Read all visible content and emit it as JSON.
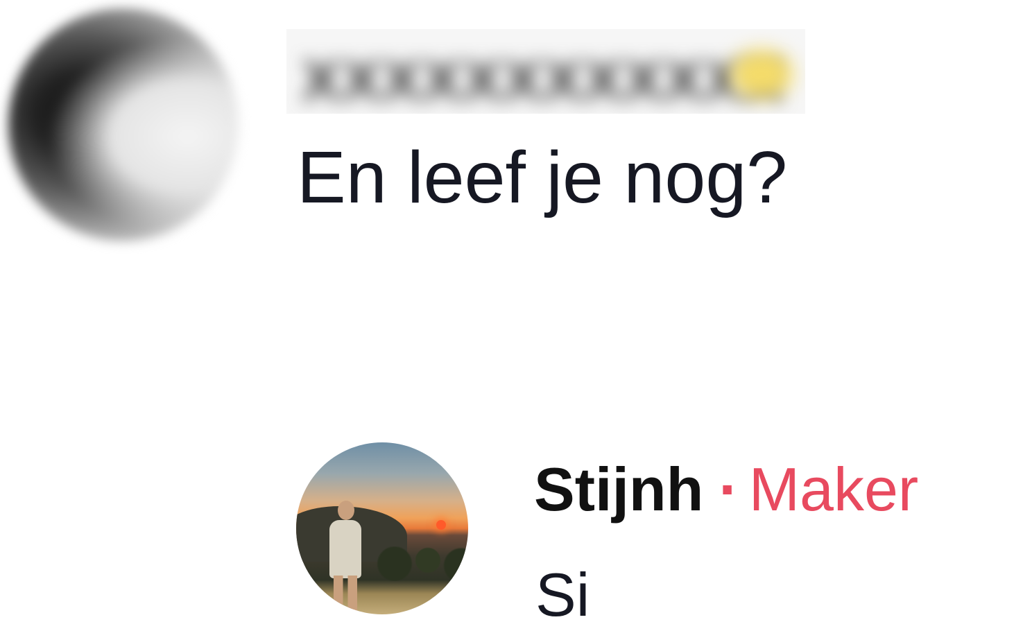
{
  "comments": [
    {
      "username": "",
      "avatar_icon": "blurred-profile-avatar",
      "text": "En leef je nog?"
    }
  ],
  "reply": {
    "username": "Stijnh",
    "separator": "·",
    "creator_label": "Maker",
    "avatar_icon": "sunset-profile-avatar",
    "text": "Si"
  },
  "colors": {
    "creator_accent": "#e84a5f",
    "text_primary": "#161823"
  }
}
